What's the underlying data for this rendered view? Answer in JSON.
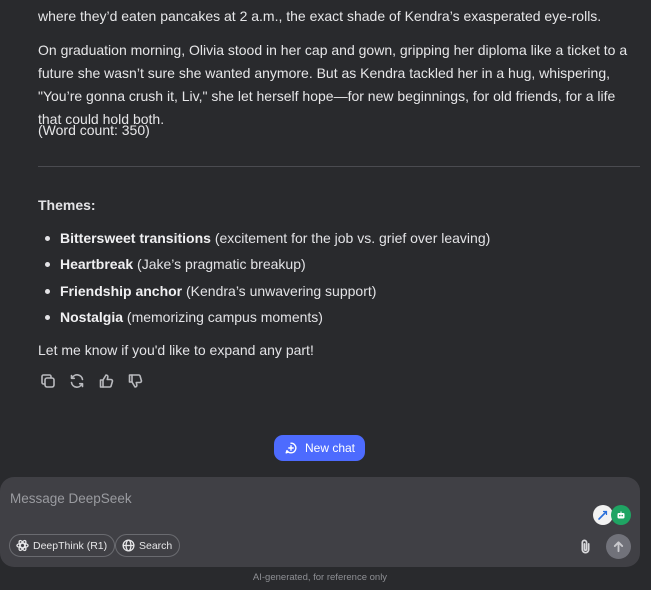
{
  "message": {
    "paragraph_top": "where they’d eaten pancakes at 2 a.m., the exact shade of Kendra’s exasperated eye-rolls.",
    "paragraph_graduation": "On graduation morning, Olivia stood in her cap and gown, gripping her diploma like a ticket to a future she wasn’t sure she wanted anymore. But as Kendra tackled her in a hug, whispering, \"You’re gonna crush it, Liv,\" she let herself hope—for new beginnings, for old friends, for a life that could hold both.",
    "word_count": "(Word count: 350)",
    "themes_heading": "Themes:",
    "themes": [
      {
        "title": "Bittersweet transitions",
        "detail": " (excitement for the job vs. grief over leaving)"
      },
      {
        "title": "Heartbreak",
        "detail": " (Jake’s pragmatic breakup)"
      },
      {
        "title": "Friendship anchor",
        "detail": " (Kendra’s unwavering support)"
      },
      {
        "title": "Nostalgia",
        "detail": " (memorizing campus moments)"
      }
    ],
    "closing": "Let me know if you'd like to expand any part!",
    "action_icons": [
      "copy-icon",
      "regenerate-icon",
      "thumbs-up-icon",
      "thumbs-down-icon"
    ]
  },
  "new_chat": {
    "label": "New chat",
    "icon": "new-chat-icon"
  },
  "composer": {
    "placeholder": "Message DeepSeek",
    "deepthink_label": "DeepThink (R1)",
    "search_label": "Search",
    "extension_icons": [
      "edge-extension-icon",
      "bot-extension-icon"
    ],
    "attach_icon": "paperclip-icon",
    "send_icon": "arrow-up-icon"
  },
  "footer": {
    "note": "AI-generated, for reference only"
  },
  "colors": {
    "background": "#292a2d",
    "composer": "#404045",
    "accent": "#4d6bfe",
    "bot_extension": "#1fa463"
  }
}
